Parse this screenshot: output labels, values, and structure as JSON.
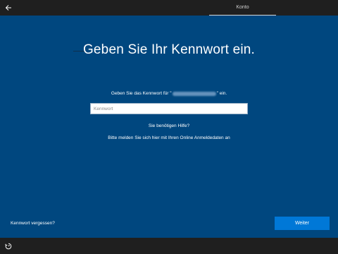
{
  "header": {
    "back_icon": "back-arrow-icon",
    "tab_label": "Konto"
  },
  "main": {
    "title": "Geben Sie Ihr Kennwort ein.",
    "prompt_prefix": "Geben Sie das Kennwort für \"",
    "prompt_suffix": "\" ein.",
    "password": {
      "value": "",
      "placeholder": "Kennwort"
    },
    "help_link": "Sie benötigen Hilfe?",
    "online_link": "Bitte melden Sie sich hier mit Ihren Online Anmeldedaten an",
    "forgot_link": "Kennwort vergessen?",
    "next_button": "Weiter"
  },
  "footer": {
    "ease_icon": "ease-of-access-icon"
  },
  "colors": {
    "background": "#00477f",
    "accent": "#0078d7",
    "chrome": "#1f1f1f"
  }
}
